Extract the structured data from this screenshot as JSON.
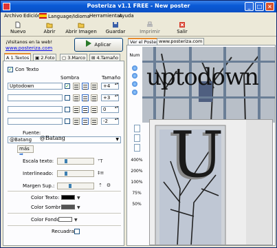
{
  "window": {
    "title": "Posteriza v1.1 FREE - New poster"
  },
  "menu": {
    "items": [
      "Archivo",
      "Edición",
      "Language/Idioma",
      "Herramientas",
      "Ayuda"
    ]
  },
  "toolbar": {
    "new_label": "Nuevo",
    "open_label": "Abrir",
    "open_image_label": "Abrir Imagen",
    "save_label": "Guardar",
    "print_label": "Imprimir",
    "exit_label": "Salir"
  },
  "left": {
    "visit_text": "¡Visitanos en la web!",
    "site_link": "www.posteriza.com",
    "apply_label": "Aplicar",
    "tabs": [
      "1.Textos",
      "2.Foto",
      "3.Marco",
      "4.Tamaño"
    ],
    "con_texto_label": "Con Texto",
    "sombra_label": "Sombra",
    "tamano_label": "Tamaño",
    "rows": [
      {
        "text": "Uptodown",
        "shadow": true,
        "size": "+4"
      },
      {
        "text": "",
        "shadow": false,
        "size": "+3"
      },
      {
        "text": "",
        "shadow": false,
        "size": "0"
      },
      {
        "text": "",
        "shadow": false,
        "size": "-2"
      }
    ],
    "fuente_label": "Fuente:",
    "font_value": "@Batang",
    "font_preview": "@Batang",
    "mas_label": "más",
    "escala_label": "Escala texto:",
    "interlineado_label": "Interlineado:",
    "margen_label": "Margen Sup.:",
    "color_texto_label": "Color Texto:",
    "color_sombra_label": "Color Sombra:",
    "color_fondo_label": "Color Fondo",
    "recuadro_label": "Recuadra:",
    "colors": {
      "texto": "#000000",
      "sombra": "#555555",
      "fondo": "#ffffff"
    }
  },
  "right": {
    "tab_label": "Ver el Poster",
    "url_label": "www.posteriza.com",
    "num_label": "Num",
    "preview_text": "uptodown",
    "poster_letter": "U",
    "zoom_levels": [
      "400%",
      "200%",
      "100%",
      "75%",
      "50%"
    ]
  }
}
